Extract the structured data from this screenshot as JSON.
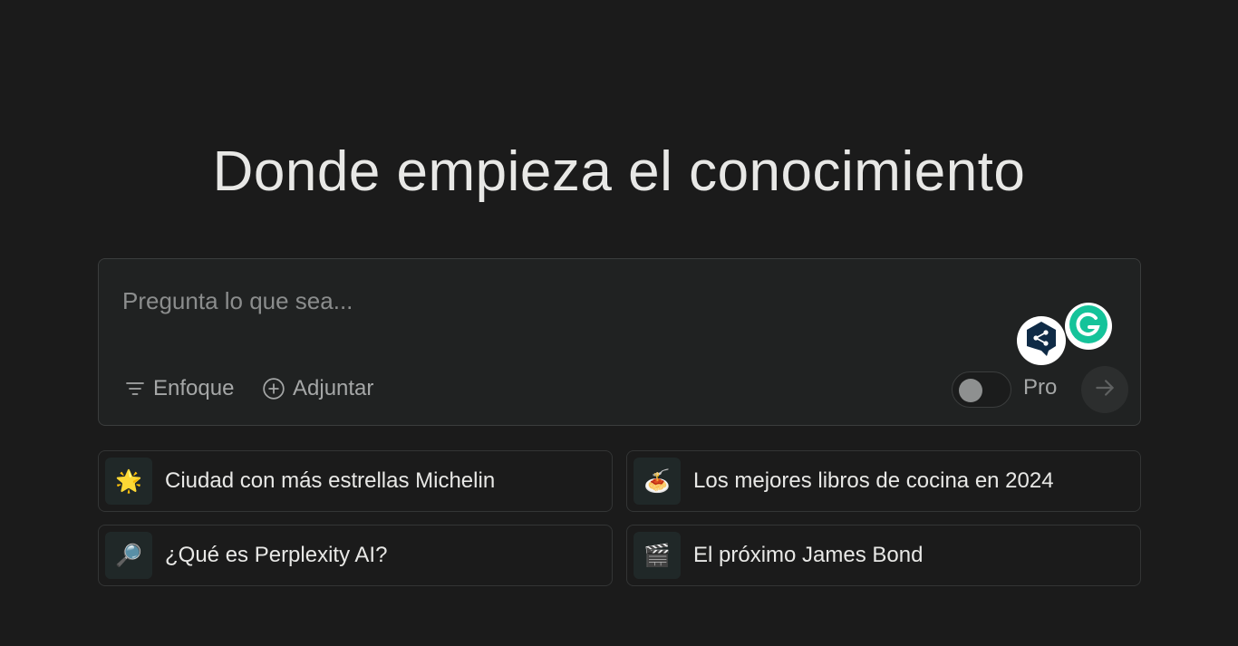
{
  "headline": "Donde empieza el conocimiento",
  "search": {
    "placeholder": "Pregunta lo que sea...",
    "value": "",
    "focus_label": "Enfoque",
    "attach_label": "Adjuntar",
    "pro_label": "Pro",
    "pro_enabled": false
  },
  "extensions": {
    "deepl_icon": "deepl-icon",
    "grammarly_icon": "grammarly-icon"
  },
  "suggestions": [
    {
      "icon": "🌟",
      "label": "Ciudad con más estrellas Michelin"
    },
    {
      "icon": "🍝",
      "label": "Los mejores libros de cocina en 2024"
    },
    {
      "icon": "🔎",
      "label": "¿Qué es Perplexity AI?"
    },
    {
      "icon": "🎬",
      "label": "El próximo James Bond"
    }
  ],
  "colors": {
    "background": "#1b1b1b",
    "search_box": "#202222",
    "border": "#3b3d3d",
    "muted_text": "#a5a7a7",
    "grammarly": "#15c39a",
    "deepl": "#0f2b46"
  }
}
